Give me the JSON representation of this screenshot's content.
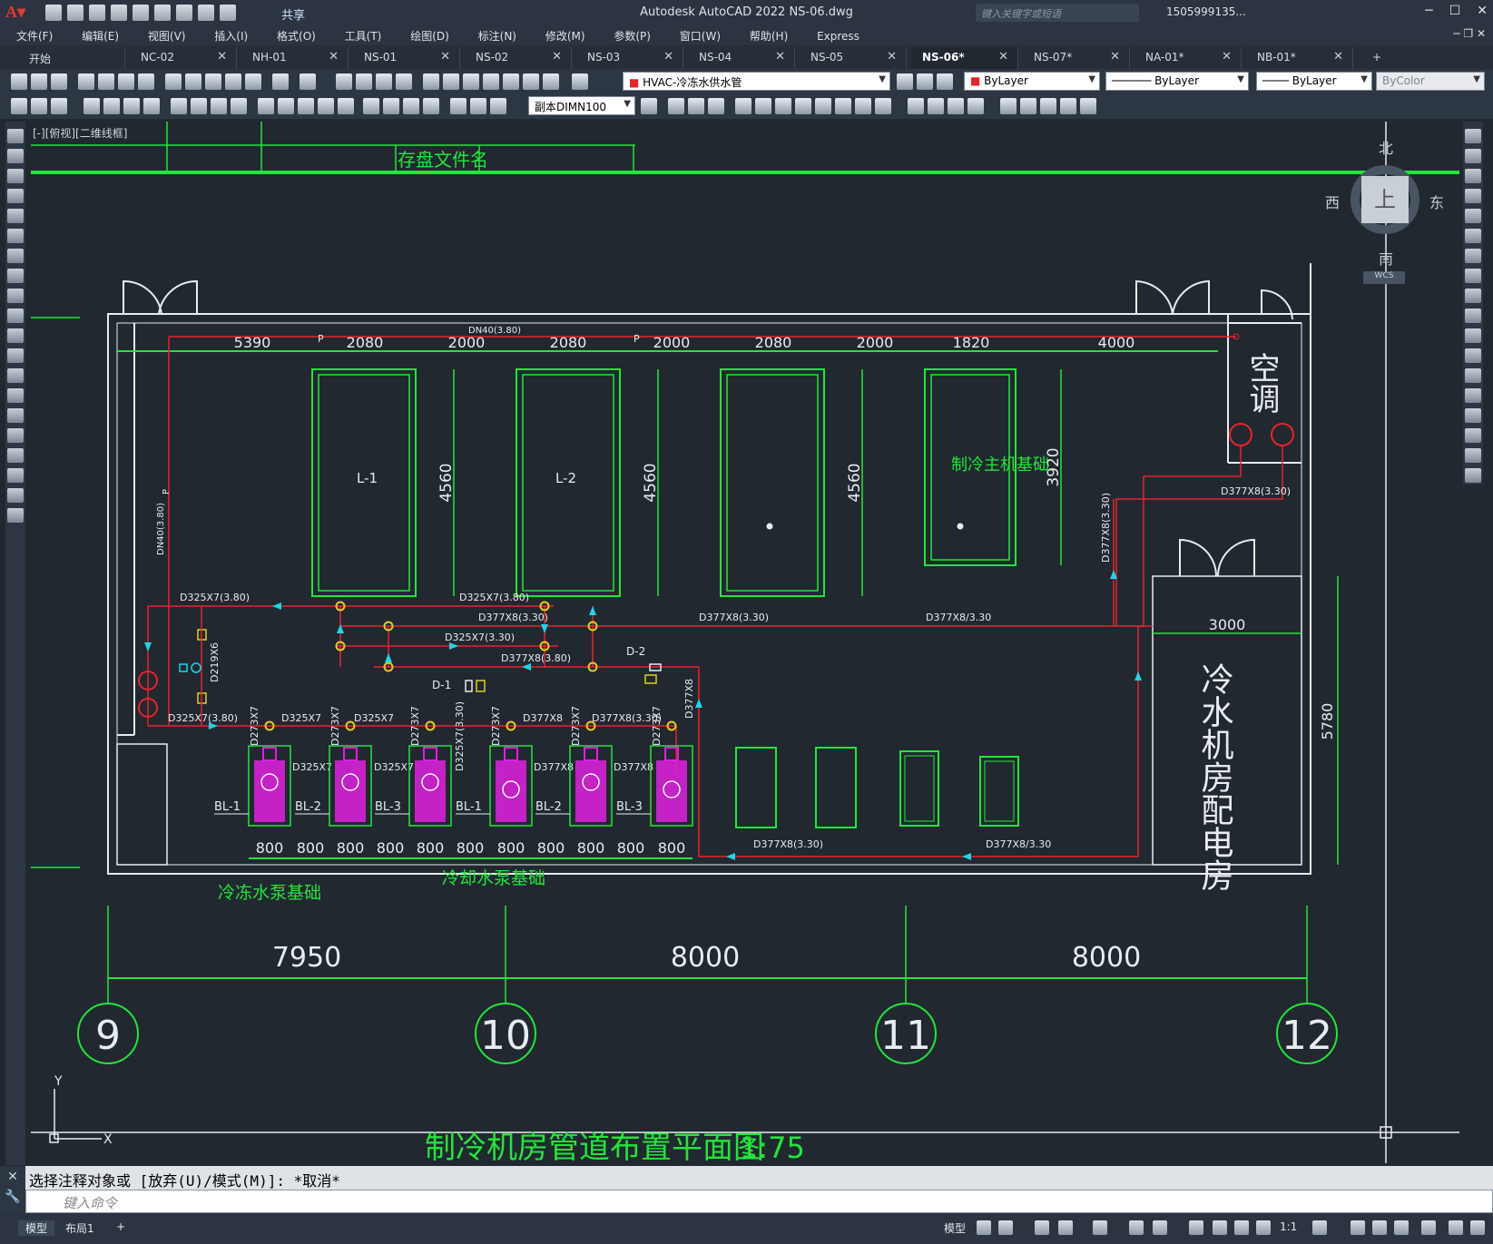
{
  "app": {
    "title": "Autodesk AutoCAD 2022    NS-06.dwg",
    "share_label": "共享",
    "search_placeholder": "键入关键字或短语",
    "user": "1505999135..."
  },
  "menu": [
    "文件(F)",
    "编辑(E)",
    "视图(V)",
    "插入(I)",
    "格式(O)",
    "工具(T)",
    "绘图(D)",
    "标注(N)",
    "修改(M)",
    "参数(P)",
    "窗口(W)",
    "帮助(H)",
    "Express"
  ],
  "tabs": [
    "开始",
    "NC-02",
    "NH-01",
    "NS-01",
    "NS-02",
    "NS-03",
    "NS-04",
    "NS-05",
    "NS-06*",
    "NS-07*",
    "NA-01*",
    "NB-01*"
  ],
  "toolbar": {
    "layer": "HVAC-冷冻水供水管",
    "color": "ByLayer",
    "linetype": "ByLayer",
    "lineweight": "ByLayer",
    "plotstyle": "ByColor",
    "dimstyle": "副本DIMN100"
  },
  "viewport": {
    "label": "[-][俯视][二维线框]",
    "viewcube": {
      "north": "北",
      "south": "南",
      "east": "东",
      "west": "西",
      "top": "上",
      "wcs": "WCS"
    }
  },
  "drawing": {
    "file_name_label": "存盘文件名",
    "dims_top": [
      "5390",
      "2080",
      "2000",
      "2080",
      "2000",
      "2080",
      "2000",
      "1820",
      "4000"
    ],
    "pipe_top": "DN40(3.80)",
    "pipe_left": "DN40(3.80)",
    "chillers": [
      "L-1",
      "L-2"
    ],
    "chiller_height": "4560",
    "chiller_height_2": "3920",
    "chiller_base_label": "制冷主机基础",
    "ac_label": "空调",
    "room_label": "冷水机房配电房",
    "room_width": "3000",
    "room_height": "5780",
    "pipes": {
      "d325_380": "D325X7(3.80)",
      "d325_380b": "D325X7(3.80)",
      "d377_330": "D377X8(3.30)",
      "d377_330b": "D377X8/3.30",
      "d325_330": "D325X7(3.30)",
      "d377_380": "D377X8(3.80)",
      "d377_330c": "D377X8(3.30)",
      "d325_380c": "D325X7(3.80)",
      "d219": "D219X6",
      "d325x7": "D325X7",
      "d377x8": "D377X8",
      "d273x7": "D273X7",
      "d377_330_bot": "D377X8(3.30)",
      "d377_330_bot2": "D377X8/3.30"
    },
    "valves": [
      "D-1",
      "D-2"
    ],
    "pumps": [
      "BL-1",
      "BL-2",
      "BL-3",
      "BL-1",
      "BL-2",
      "BL-3"
    ],
    "pump_spacing": [
      "800",
      "800",
      "800",
      "800",
      "800",
      "800",
      "800",
      "800",
      "800",
      "800",
      "800"
    ],
    "chilled_pump_label": "冷冻水泵基础",
    "cooling_pump_label": "冷却水泵基础",
    "grid_dims": [
      "7950",
      "8000",
      "8000"
    ],
    "grid_axes": [
      "9",
      "10",
      "11",
      "12"
    ],
    "plan_title": "制冷机房管道布置平面图",
    "scale": "1:75",
    "p_label": "P"
  },
  "command": {
    "history": "选择注释对象或 [放弃(U)/模式(M)]: *取消*",
    "placeholder": "键入命令"
  },
  "status": {
    "model_tab": "模型",
    "layout_tab": "布局1",
    "model_label": "模型",
    "scale": "1:1"
  },
  "colors": {
    "green": "#22e63a",
    "red": "#e8232c",
    "cyan": "#1ed6e6",
    "magenta": "#e020e0",
    "yellow": "#e0d020",
    "white": "#e8ecef"
  }
}
